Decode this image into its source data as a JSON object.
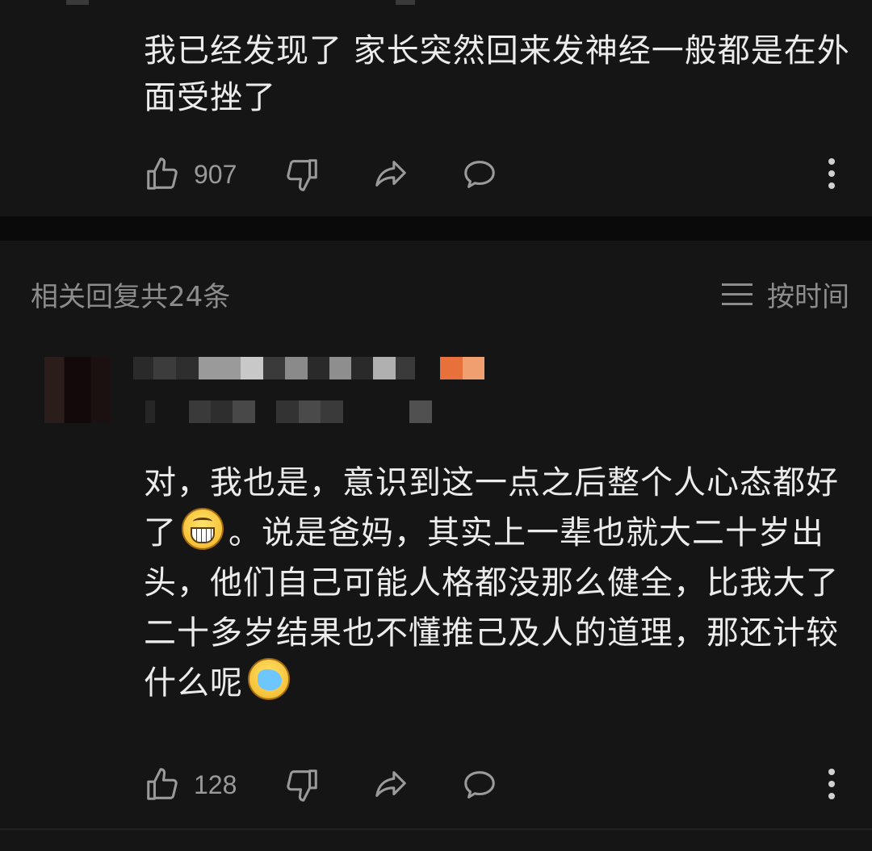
{
  "comment": {
    "text": "我已经发现了 家长突然回来发神经一般都是在外面受挫了",
    "like_count": "907"
  },
  "replies": {
    "header": "相关回复共24条",
    "sort_label": "按时间"
  },
  "reply": {
    "text_part1": "对，我也是，意识到这一点之后整个人心态都好了",
    "text_part2": "。说是爸妈，其实上一辈也就大二十岁出头，他们自己可能人格都没那么健全，比我大了二十多岁结果也不懂推己及人的道理，那还计较什么呢",
    "emoji1": "grinning-face",
    "emoji2": "crying-laughing-face",
    "like_count": "128"
  },
  "colors": {
    "background": "#151515",
    "text": "#ececec",
    "muted": "#8c8c8c",
    "badge": "#e8703a"
  }
}
